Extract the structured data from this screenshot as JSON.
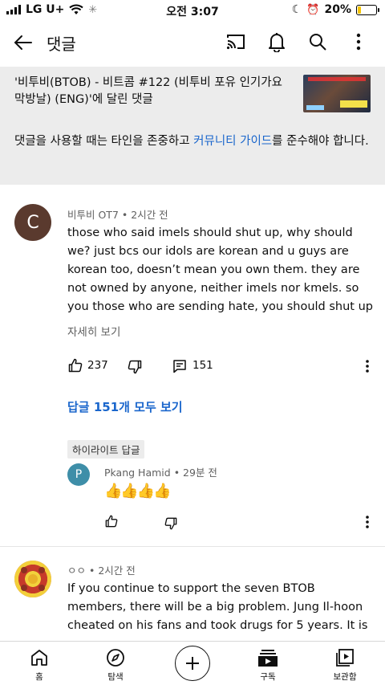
{
  "status_bar": {
    "carrier": "LG U+",
    "time": "오전 3:07",
    "battery_percent": "20%",
    "battery_level": 0.2
  },
  "header": {
    "title": "댓글",
    "icons": [
      "back-arrow-icon",
      "cast-icon",
      "bell-icon",
      "search-icon",
      "more-vert-icon"
    ]
  },
  "video": {
    "title": "'비투비(BTOB) - 비트콤 #122 (비투비 포유 인기가요 막방날) (ENG)'에 달린 댓글",
    "guideline_prefix": "댓글을 사용할 때는 타인을 존중하고 ",
    "guideline_link": "커뮤니티 가이드",
    "guideline_suffix": "를 준수해야 합니다."
  },
  "comments": [
    {
      "avatar_letter": "C",
      "avatar_color": "#5a3a2e",
      "author": "비투비 OT7",
      "time": "2시간 전",
      "text": "those who said imels should shut up, why should we? just bcs our idols are korean and u guys are korean too, doesn’t mean you own them. they are not owned by anyone, neither imels nor kmels. so you those who are sending hate, you should shut up",
      "read_more": "자세히 보기",
      "likes": "237",
      "reply_count": "151",
      "view_replies": "답글 151개 모두 보기",
      "highlight_label": "하이라이트 답글",
      "highlight_reply": {
        "avatar_letter": "P",
        "avatar_color": "#3e8ea8",
        "author": "Pkang Hamid",
        "time": "29분 전",
        "text": "👍👍👍👍"
      }
    },
    {
      "author": "ㅇㅇ",
      "time": "2시간 전",
      "text": "If you continue to support the seven BTOB members, there will be a big problem. Jung Il-hoon cheated on his fans and took drugs for 5 years. It is"
    }
  ],
  "bottom_nav": [
    {
      "label": "홈",
      "icon": "home-icon"
    },
    {
      "label": "탐색",
      "icon": "explore-icon"
    },
    {
      "label": "",
      "icon": "create-plus-icon"
    },
    {
      "label": "구독",
      "icon": "subscriptions-icon"
    },
    {
      "label": "보관함",
      "icon": "library-icon"
    }
  ]
}
